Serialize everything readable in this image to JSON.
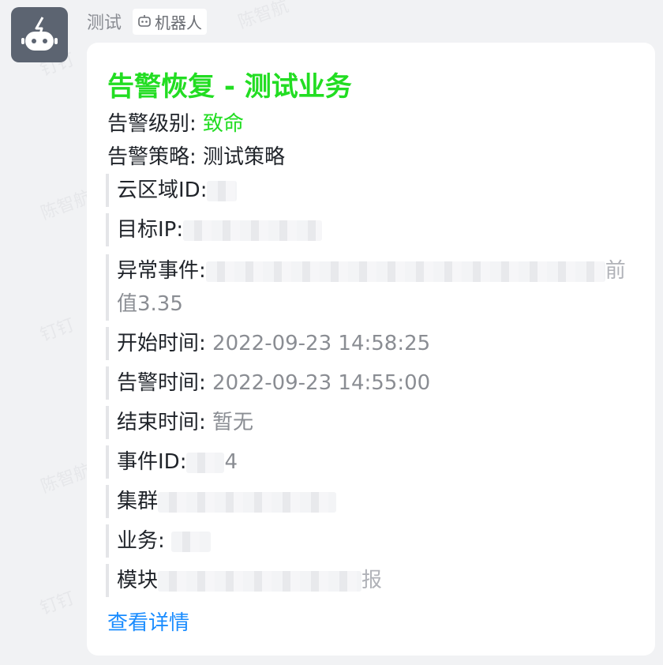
{
  "sender": {
    "name": "测试",
    "badge_label": "机器人"
  },
  "watermark": {
    "text_name": "陈智航",
    "text_app": "钉钉"
  },
  "message": {
    "title": "告警恢复 - 测试业务",
    "level_label": "告警级别:",
    "level_value": "致命",
    "strategy_label": "告警策略:",
    "strategy_value": "测试策略",
    "rows": [
      {
        "label": "云区域ID:",
        "value": "",
        "tail": ""
      },
      {
        "label": "目标IP:",
        "value": "",
        "tail": ""
      },
      {
        "label": "异常事件:",
        "value": "值3.35",
        "tail": "前"
      },
      {
        "label": "开始时间:",
        "value": "2022-09-23 14:58:25",
        "tail": ""
      },
      {
        "label": "告警时间:",
        "value": "2022-09-23 14:55:00",
        "tail": ""
      },
      {
        "label": "结束时间:",
        "value": "暂无",
        "tail": ""
      },
      {
        "label": "事件ID:",
        "value": "4",
        "tail": ""
      },
      {
        "label": "集群",
        "value": "",
        "tail": ""
      },
      {
        "label": "业务:",
        "value": "",
        "tail": ""
      },
      {
        "label": "模块",
        "value": "",
        "tail": "报"
      }
    ],
    "details_link": "查看详情"
  },
  "colors": {
    "title_green": "#22dd22",
    "link_blue": "#1a8cff",
    "avatar_bg": "#5c6471"
  }
}
